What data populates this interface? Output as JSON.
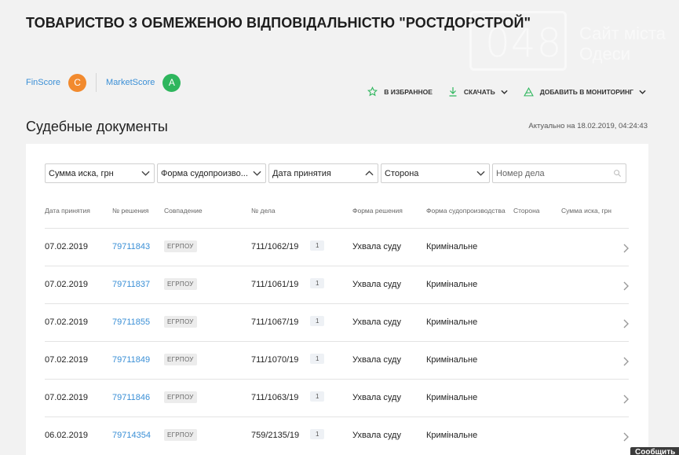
{
  "company": {
    "title": "ТОВАРИСТВО З ОБМЕЖЕНОЮ ВІДПОВІДАЛЬНІСТЮ \"РОСТДОРСТРОЙ\""
  },
  "watermark": {
    "number": "048",
    "line1": "Сайт міста",
    "line2": "Одеси"
  },
  "scores": {
    "finscore_label": "FinScore",
    "finscore_grade": "C",
    "marketscore_label": "MarketScore",
    "marketscore_grade": "A"
  },
  "actions": {
    "favorite": "В ИЗБРАННОЕ",
    "download": "СКАЧАТЬ",
    "monitor": "ДОБАВИТЬ В МОНИТОРИНГ"
  },
  "section": {
    "title": "Судебные документы",
    "updated": "Актуально на 18.02.2019, 04:24:43"
  },
  "filters": {
    "claim_sum": "Сумма иска, грн",
    "proceeding_form": "Форма судопроизво...",
    "adoption_date": "Дата принятия",
    "party": "Сторона",
    "case_number_placeholder": "Номер дела"
  },
  "columns": {
    "date": "Дата принятия",
    "decision_no": "№ решения",
    "match": "Совпадение",
    "case_no": "№ дела",
    "decision_form": "Форма решения",
    "proceeding_form": "Форма судопроизводства",
    "party": "Сторона",
    "claim_sum": "Сумма иска, грн"
  },
  "rows": [
    {
      "date": "07.02.2019",
      "decision_no": "79711843",
      "match": "ЕГРПОУ",
      "case_no": "711/1062/19",
      "count": "1",
      "decision_form": "Ухвала суду",
      "proceeding_form": "Кримінальне"
    },
    {
      "date": "07.02.2019",
      "decision_no": "79711837",
      "match": "ЕГРПОУ",
      "case_no": "711/1061/19",
      "count": "1",
      "decision_form": "Ухвала суду",
      "proceeding_form": "Кримінальне"
    },
    {
      "date": "07.02.2019",
      "decision_no": "79711855",
      "match": "ЕГРПОУ",
      "case_no": "711/1067/19",
      "count": "1",
      "decision_form": "Ухвала суду",
      "proceeding_form": "Кримінальне"
    },
    {
      "date": "07.02.2019",
      "decision_no": "79711849",
      "match": "ЕГРПОУ",
      "case_no": "711/1070/19",
      "count": "1",
      "decision_form": "Ухвала суду",
      "proceeding_form": "Кримінальне"
    },
    {
      "date": "07.02.2019",
      "decision_no": "79711846",
      "match": "ЕГРПОУ",
      "case_no": "711/1063/19",
      "count": "1",
      "decision_form": "Ухвала суду",
      "proceeding_form": "Кримінальне"
    },
    {
      "date": "06.02.2019",
      "decision_no": "79714354",
      "match": "ЕГРПОУ",
      "case_no": "759/2135/19",
      "count": "1",
      "decision_form": "Ухвала суду",
      "proceeding_form": "Кримінальне"
    }
  ],
  "footer": {
    "message_tab": "Сообщить"
  },
  "colors": {
    "link": "#3a8fd6",
    "grade_c": "#f28a2e",
    "grade_a": "#2eb65d",
    "accent_green": "#2eb65d"
  }
}
